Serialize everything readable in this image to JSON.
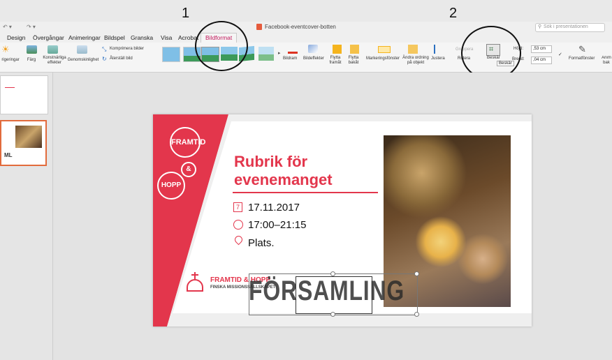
{
  "annotations": {
    "one": "1",
    "two": "2"
  },
  "window": {
    "title": "Facebook-eventcover-botten",
    "search_placeholder": "Sök i presentationen",
    "share_label": "D"
  },
  "quick_access": {
    "undo": "↶ ▾",
    "redo": "↷ ▾"
  },
  "tabs": [
    "Design",
    "Övergångar",
    "Animeringar",
    "Bildspel",
    "Granska",
    "Visa",
    "Acrobat"
  ],
  "active_tab": "Bildformat",
  "ribbon": {
    "korrigeringar": "rigeringar",
    "farg": "Färg",
    "konstnarliga": "Konstnärliga effekter",
    "genomskinlighet": "Genomskinlighet",
    "komprimera": "Komprimera bilder",
    "aterstall": "Återställ bild",
    "bildram": "Bildram",
    "bildeffekter": "Bildeffekter",
    "flytta_framat": "Flytta framåt",
    "flytta_bakat": "Flytta bakåt",
    "markeringsfonster": "Markeringsfönster",
    "andra_ordning": "Ändra ordning på objekt",
    "justera": "Justera",
    "gruppera": "Gruppera",
    "rotera": "Rotera",
    "beskar": "Beskär",
    "tooltip": "Beskär",
    "hojd_label": "Höjd:",
    "hojd_value": ",53 cm",
    "bredd_label": "Bredd:",
    "bredd_value": ",04 cm",
    "formatfonster": "Formatfönster",
    "animering": "Anim bak"
  },
  "thumbnail": {
    "label": "ML"
  },
  "slide": {
    "logo_top": "FRAMTID",
    "logo_amp": "&",
    "logo_bottom": "HOPP",
    "title_line1": "Rubrik för",
    "title_line2": "evenemanget",
    "date": "17.11.2017",
    "time": "17:00–21:15",
    "place": "Plats.",
    "date_icon_number": "7",
    "brand_name": "FRAMTID & HOPP",
    "brand_sub": "FINSKA MISSIONSSÄLLSKAPET",
    "overlay_text": "FÖRSAMLING"
  },
  "colors": {
    "accent": "#e3364c",
    "active_tab": "#c2185b"
  }
}
